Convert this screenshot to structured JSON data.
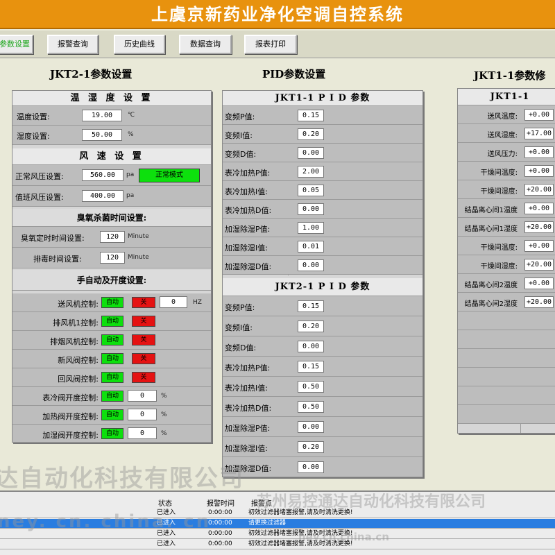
{
  "app": {
    "title": "上虞京新药业净化空调自控系统"
  },
  "nav": {
    "items": [
      {
        "label": "参数设置",
        "active": true
      },
      {
        "label": "报警查询"
      },
      {
        "label": "历史曲线"
      },
      {
        "label": "数据查询"
      },
      {
        "label": "报表打印"
      }
    ]
  },
  "jkt21": {
    "section_title": "JKT2-1参数设置",
    "temp_header": "温 湿 度 设 置",
    "temp_label": "温度设置:",
    "temp_value": "19.00",
    "temp_unit": "℃",
    "hum_label": "湿度设置:",
    "hum_value": "50.00",
    "hum_unit": "%",
    "wind_header": "风 速 设 置",
    "normal_label": "正常风压设置:",
    "normal_value": "560.00",
    "normal_unit": "pa",
    "mode_label": "正常模式",
    "duty_label": "值班风压设置:",
    "duty_value": "400.00",
    "duty_unit": "pa",
    "ozone_header": "臭氧杀菌时间设置:",
    "ozone_timer_label": "臭氧定时时间设置:",
    "ozone_timer_value": "120",
    "ozone_timer_unit": "Minute",
    "exhaust_timer_label": "排毒时间设置:",
    "exhaust_timer_value": "120",
    "exhaust_timer_unit": "Minute",
    "manual_header": "手自动及开度设置:",
    "controls": [
      {
        "label": "送风机控制:",
        "auto": "自动",
        "state": "关",
        "value": "0",
        "unit": "HZ"
      },
      {
        "label": "排风机1控制:",
        "auto": "自动",
        "state": "关"
      },
      {
        "label": "排烟风机控制:",
        "auto": "自动",
        "state": "关"
      },
      {
        "label": "新风阀控制:",
        "auto": "自动",
        "state": "关"
      },
      {
        "label": "回风阀控制:",
        "auto": "自动",
        "state": "关"
      },
      {
        "label": "表冷阀开度控制:",
        "auto": "自动",
        "value": "0",
        "unit": "%"
      },
      {
        "label": "加热阀开度控制:",
        "auto": "自动",
        "value": "0",
        "unit": "%"
      },
      {
        "label": "加湿阀开度控制:",
        "auto": "自动",
        "value": "0",
        "unit": "%"
      }
    ]
  },
  "pid": {
    "section_title": "PID参数设置",
    "jkt11_header": "JKT1-1 P I D 参数",
    "jkt11_rows": [
      {
        "label": "变频P值:",
        "value": "0.15"
      },
      {
        "label": "变频I值:",
        "value": "0.20"
      },
      {
        "label": "变频D值:",
        "value": "0.00"
      },
      {
        "label": "表冷加热P值:",
        "value": "2.00"
      },
      {
        "label": "表冷加热I值:",
        "value": "0.05"
      },
      {
        "label": "表冷加热D值:",
        "value": "0.00"
      },
      {
        "label": "加湿除湿P值:",
        "value": "1.00"
      },
      {
        "label": "加湿除湿I值:",
        "value": "0.01"
      },
      {
        "label": "加湿除湿D值:",
        "value": "0.00"
      }
    ],
    "jkt21_header": "JKT2-1 P I D 参数",
    "jkt21_rows": [
      {
        "label": "变频P值:",
        "value": "0.15"
      },
      {
        "label": "变频I值:",
        "value": "0.20"
      },
      {
        "label": "变频D值:",
        "value": "0.00"
      },
      {
        "label": "表冷加热P值:",
        "value": "0.15"
      },
      {
        "label": "表冷加热I值:",
        "value": "0.50"
      },
      {
        "label": "表冷加热D值:",
        "value": "0.50"
      },
      {
        "label": "加湿除湿P值:",
        "value": "0.00"
      },
      {
        "label": "加湿除湿I值:",
        "value": "0.20"
      },
      {
        "label": "加湿除湿D值:",
        "value": "0.00"
      }
    ]
  },
  "jkt11": {
    "section_title": "JKT1-1参数修",
    "header": "JKT1-1",
    "rows": [
      {
        "label": "送风温度:",
        "value": "+0.00"
      },
      {
        "label": "送风湿度:",
        "value": "+17.00"
      },
      {
        "label": "送风压力:",
        "value": "+0.00"
      },
      {
        "label": "干燥间温度:",
        "value": "+0.00"
      },
      {
        "label": "干燥间湿度:",
        "value": "+20.00"
      },
      {
        "label": "结晶离心间1温度",
        "value": "+0.00"
      },
      {
        "label": "结晶离心间1湿度",
        "value": "+20.00"
      },
      {
        "label": "干燥间温度:",
        "value": "+0.00"
      },
      {
        "label": "干燥间湿度:",
        "value": "+20.00"
      },
      {
        "label": "结晶离心间2温度",
        "value": "+0.00"
      },
      {
        "label": "结晶离心间2湿度",
        "value": "+20.00"
      }
    ]
  },
  "log": {
    "headers": [
      "状态",
      "报警时间",
      "报警点"
    ],
    "rows": [
      {
        "status": "已进入",
        "time": "0:00:00",
        "point": "初效过滤器堵塞报警,请及时清洗更换!"
      },
      {
        "status": "已进入",
        "time": "0:00:00",
        "point": "请更换过滤器",
        "selected": true
      },
      {
        "status": "已进入",
        "time": "0:00:00",
        "point": "初效过滤器堵塞报警,请及时清洗更换!"
      },
      {
        "status": "已进入",
        "time": "0:00:00",
        "point": "初效过滤器堵塞报警,请及时清洗更换!"
      }
    ]
  },
  "watermarks": {
    "company": "苏州易控通达自动化科技有限公司",
    "company_partial": "达自动化科技有限公司",
    "site": "hey.cn.china.cn",
    "site_partial": "ney. cn. china. cn"
  }
}
